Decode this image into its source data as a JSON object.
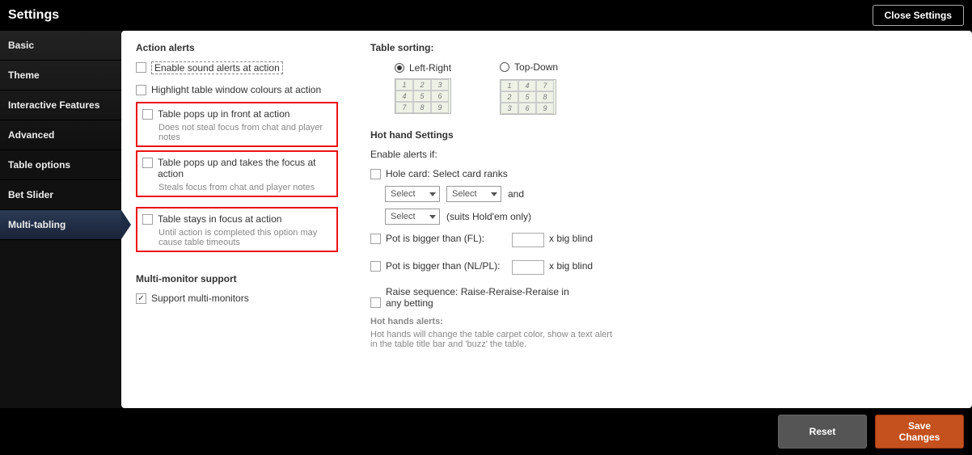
{
  "header": {
    "title": "Settings",
    "close": "Close Settings"
  },
  "sidebar": {
    "items": [
      {
        "label": "Basic"
      },
      {
        "label": "Theme"
      },
      {
        "label": "Interactive Features"
      },
      {
        "label": "Advanced"
      },
      {
        "label": "Table options"
      },
      {
        "label": "Bet Slider"
      },
      {
        "label": "Multi-tabling"
      }
    ]
  },
  "actionAlerts": {
    "title": "Action alerts",
    "sound": "Enable sound alerts at action",
    "highlight": "Highlight table window colours at action",
    "popFront": {
      "label": "Table pops up in front at action",
      "hint": "Does not steal focus from chat and player notes"
    },
    "popFocus": {
      "label": "Table pops up and takes the focus at action",
      "hint": "Steals focus from chat and player notes"
    },
    "stayFocus": {
      "label": "Table stays in focus at action",
      "hint": "Until action is completed this option may cause table timeouts"
    }
  },
  "multiMonitor": {
    "title": "Multi-monitor support",
    "support": "Support multi-monitors"
  },
  "sorting": {
    "title": "Table sorting:",
    "lr": "Left-Right",
    "td": "Top-Down"
  },
  "hothand": {
    "title": "Hot hand Settings",
    "enable": "Enable alerts if:",
    "holecard": "Hole card: Select card ranks",
    "select": "Select",
    "and": "and",
    "suits": "(suits Hold'em only)",
    "potFL": "Pot is bigger than (FL):",
    "potNL": "Pot is bigger than (NL/PL):",
    "bigblind": "x big blind",
    "raise": "Raise sequence: Raise-Reraise-Reraise in any betting",
    "alertTitle": "Hot hands alerts:",
    "alertText": "Hot hands will change the table carpet color, show a text alert in the table title bar and 'buzz' the table."
  },
  "footer": {
    "reset": "Reset",
    "save": "Save Changes"
  }
}
